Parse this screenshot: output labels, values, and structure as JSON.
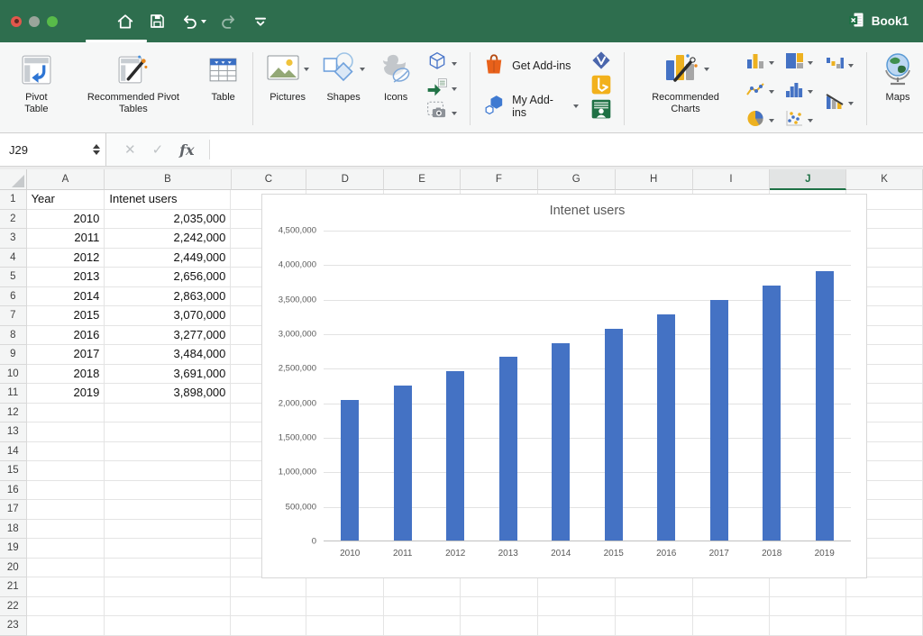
{
  "colors": {
    "titlebar_green": "#2e6e4e",
    "accent_green": "#1e7145",
    "bar_blue": "#4472c4"
  },
  "titlebar": {
    "workbook_name": "Book1"
  },
  "ribbon": {
    "pivot_table": "Pivot Table",
    "recommended_pivot_tables": "Recommended Pivot Tables",
    "table": "Table",
    "pictures": "Pictures",
    "shapes": "Shapes",
    "icons": "Icons",
    "get_addins": "Get Add-ins",
    "my_addins": "My Add-ins",
    "recommended_charts": "Recommended Charts",
    "maps": "Maps"
  },
  "formula_bar": {
    "name_box": "J29",
    "cancel_glyph": "✕",
    "enter_glyph": "✓",
    "fx_label": "fx"
  },
  "sheet": {
    "columns": [
      "A",
      "B",
      "C",
      "D",
      "E",
      "F",
      "G",
      "H",
      "I",
      "J",
      "K"
    ],
    "selected_column": "J",
    "row_count": 23,
    "header_row": {
      "year": "Year",
      "users": "Intenet users"
    },
    "records": [
      [
        "2010",
        "2,035,000"
      ],
      [
        "2011",
        "2,242,000"
      ],
      [
        "2012",
        "2,449,000"
      ],
      [
        "2013",
        "2,656,000"
      ],
      [
        "2014",
        "2,863,000"
      ],
      [
        "2015",
        "3,070,000"
      ],
      [
        "2016",
        "3,277,000"
      ],
      [
        "2017",
        "3,484,000"
      ],
      [
        "2018",
        "3,691,000"
      ],
      [
        "2019",
        "3,898,000"
      ]
    ]
  },
  "chart_data": {
    "type": "bar",
    "title": "Intenet users",
    "categories": [
      "2010",
      "2011",
      "2012",
      "2013",
      "2014",
      "2015",
      "2016",
      "2017",
      "2018",
      "2019"
    ],
    "values": [
      2035000,
      2242000,
      2449000,
      2656000,
      2863000,
      3070000,
      3277000,
      3484000,
      3691000,
      3898000
    ],
    "series_color": "#4472c4",
    "xlabel": "",
    "ylabel": "",
    "ylim": [
      0,
      4500000
    ],
    "yticks": [
      {
        "label": "0",
        "value": 0
      },
      {
        "label": "500,000",
        "value": 500000
      },
      {
        "label": "1,000,000",
        "value": 1000000
      },
      {
        "label": "1,500,000",
        "value": 1500000
      },
      {
        "label": "2,000,000",
        "value": 2000000
      },
      {
        "label": "2,500,000",
        "value": 2500000
      },
      {
        "label": "3,000,000",
        "value": 3000000
      },
      {
        "label": "3,500,000",
        "value": 3500000
      },
      {
        "label": "4,000,000",
        "value": 4000000
      },
      {
        "label": "4,500,000",
        "value": 4500000
      }
    ],
    "grid": true,
    "legend": false
  }
}
